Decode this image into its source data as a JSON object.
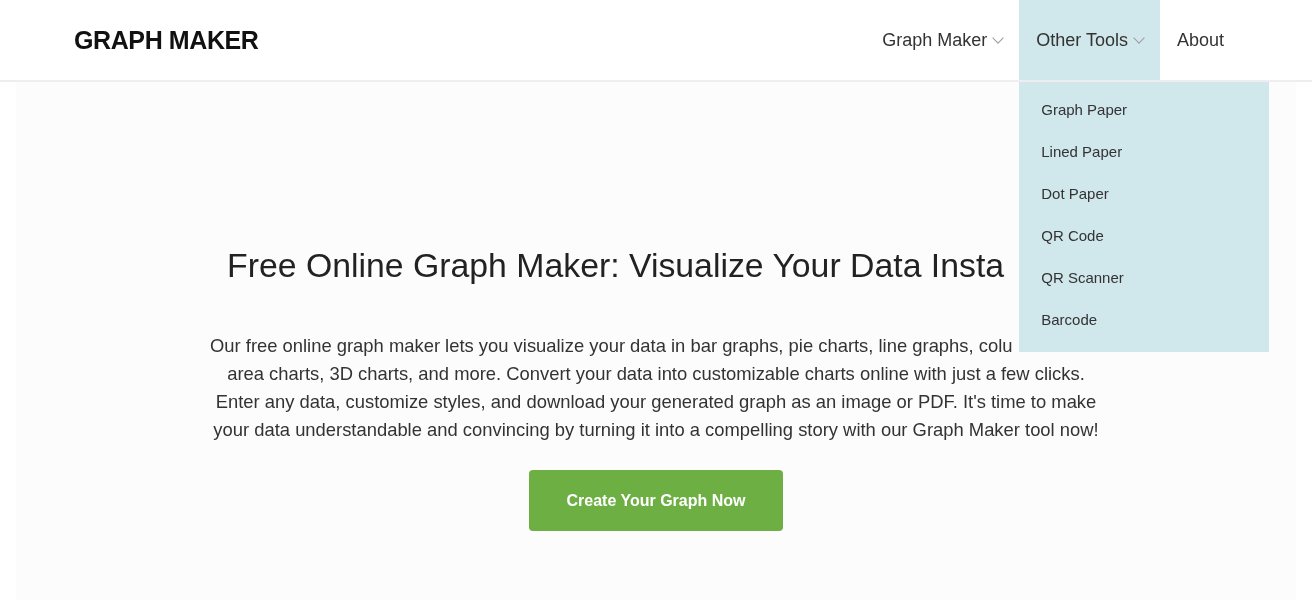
{
  "header": {
    "logo": "GRAPH MAKER",
    "nav": [
      {
        "label": "Graph Maker",
        "kind": "menu",
        "expanded": false
      },
      {
        "label": "Other Tools",
        "kind": "menu",
        "expanded": true,
        "items": [
          "Graph Paper",
          "Lined Paper",
          "Dot Paper",
          "QR Code",
          "QR Scanner",
          "Barcode"
        ]
      },
      {
        "label": "About",
        "kind": "link"
      }
    ]
  },
  "hero": {
    "title": "Free Online Graph Maker: Visualize Your Data Insta",
    "paragraph_lines": [
      "Our free online graph maker lets you visualize your data in bar graphs, pie charts, line graphs, colu",
      "area charts, 3D charts, and more. Convert your data into customizable charts online with just a few clicks.",
      "Enter any data, customize styles, and download your generated graph as an image or PDF. It's time to make",
      "your data understandable and convincing by turning it into a compelling story with our Graph Maker tool now!"
    ],
    "button": "Create Your Graph Now"
  }
}
